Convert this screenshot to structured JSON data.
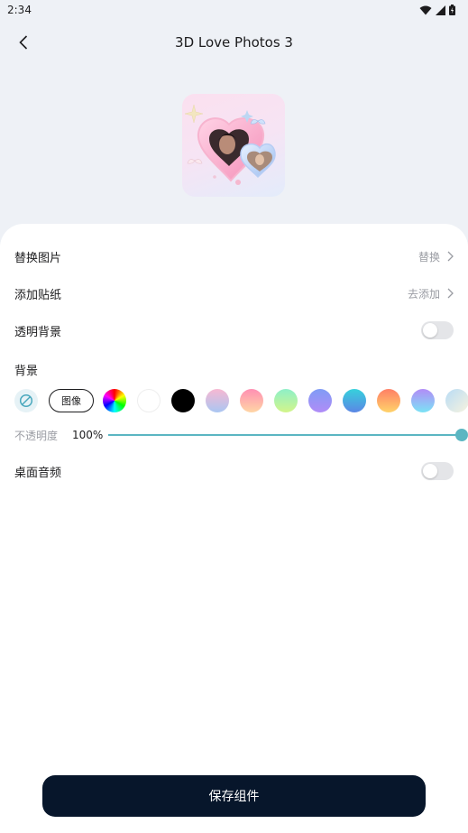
{
  "status_bar": {
    "time": "2:34"
  },
  "header": {
    "title": "3D Love Photos 3"
  },
  "rows": {
    "replace_image": {
      "label": "替换图片",
      "action": "替换"
    },
    "add_sticker": {
      "label": "添加贴纸",
      "action": "去添加"
    },
    "transparent_bg": {
      "label": "透明背景",
      "on": false
    },
    "background": {
      "label": "背景"
    },
    "desktop_audio": {
      "label": "桌面音频",
      "on": false
    }
  },
  "background_options": {
    "image_label": "图像",
    "swatches": [
      {
        "name": "rainbow",
        "fill": "conic-gradient(#ff0000, #ffff00, #00ff00, #00ffff, #0000ff, #ff00ff, #ff0000)"
      },
      {
        "name": "white",
        "fill": "#ffffff"
      },
      {
        "name": "black",
        "fill": "#000000"
      },
      {
        "name": "pink-blue",
        "fill": "linear-gradient(180deg, #f7b8d2, #a9c6f2)"
      },
      {
        "name": "pink-peach",
        "fill": "linear-gradient(180deg, #ff8fb3, #ffd6a5)"
      },
      {
        "name": "mint-green",
        "fill": "linear-gradient(180deg, #8ef0c8, #d3f58a)"
      },
      {
        "name": "blue-violet",
        "fill": "linear-gradient(180deg, #7f9cf5, #b18cf7)"
      },
      {
        "name": "aqua-blue",
        "fill": "linear-gradient(180deg, #36d1dc, #5b86e5)"
      },
      {
        "name": "orange-yellow",
        "fill": "linear-gradient(180deg, #ff7f66, #ffd36a)"
      },
      {
        "name": "violet-cyan",
        "fill": "linear-gradient(180deg, #b28cf7, #7be3f5)"
      },
      {
        "name": "sky-cream",
        "fill": "linear-gradient(135deg, #b9dcf5, #f7f3df)"
      }
    ]
  },
  "opacity": {
    "label": "不透明度",
    "value_text": "100%",
    "fraction": 1.0
  },
  "save_button": {
    "label": "保存组件"
  },
  "colors": {
    "accent": "#5bb6c2",
    "button_bg": "#07162b",
    "page_bg": "#eef1f6"
  }
}
